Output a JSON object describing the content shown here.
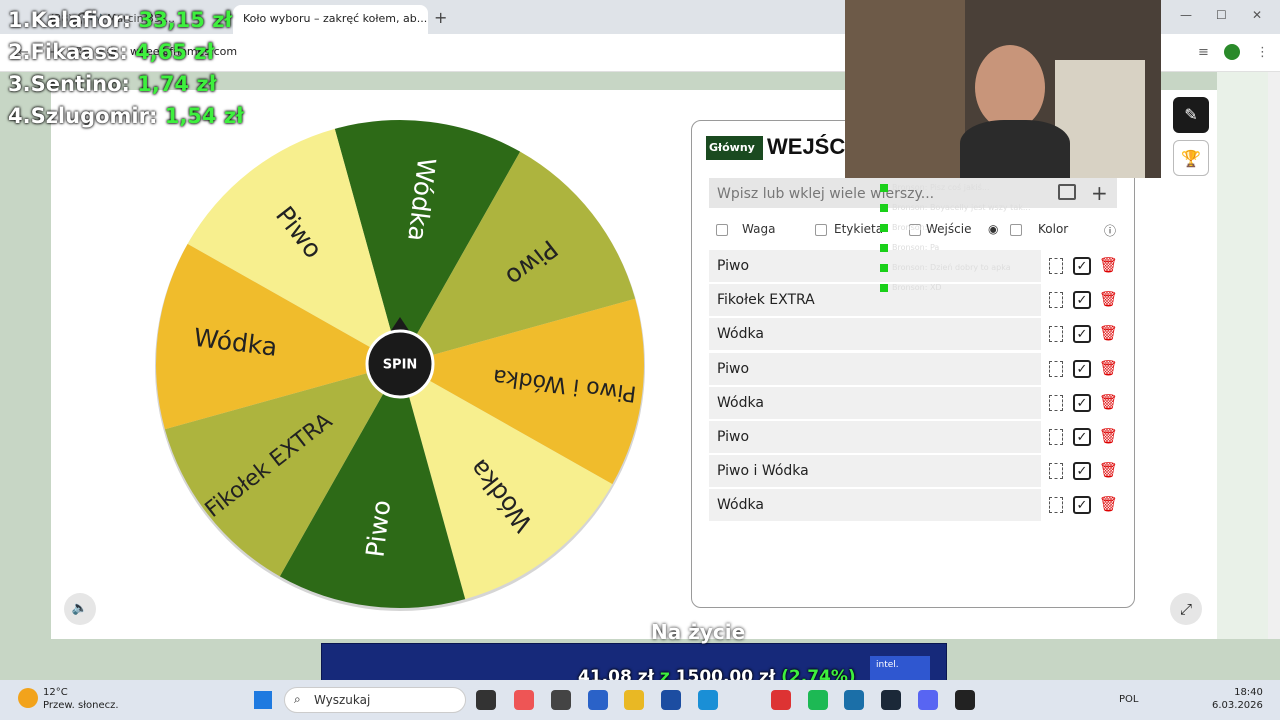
{
  "browser": {
    "tab1_title": "(28) 🎧🎶 Marcin 35 ...",
    "tab2_title": "Koło wyboru – zakręć kołem, ab...",
    "url": "wheelofnames.com"
  },
  "overlay": {
    "ranking": [
      {
        "label": "1.Kalafior:",
        "amount": "33,15 zł"
      },
      {
        "label": "2.Fikaass:",
        "amount": "4,65 zł"
      },
      {
        "label": "3.Sentino:",
        "amount": "1,74 zł"
      },
      {
        "label": "4.Szlugomir:",
        "amount": "1,54 zł"
      }
    ],
    "goal_label": "Na życie",
    "goal_current": "41,08 zł",
    "goal_sep": "z",
    "goal_target": "1500,00 zł",
    "goal_percent": "(2.74%)",
    "goal_fraction": 0.0274
  },
  "wheel": {
    "center_label": "SPIN",
    "segments": [
      {
        "label": "Wódka",
        "color": "#2d6a17",
        "text_color": "#ffffff"
      },
      {
        "label": "Piwo",
        "color": "#adb43e",
        "text_color": "#222222"
      },
      {
        "label": "Piwo i Wódka",
        "color": "#f0bc2c",
        "text_color": "#222222"
      },
      {
        "label": "Wódka",
        "color": "#f7ef8e",
        "text_color": "#222222"
      },
      {
        "label": "Piwo",
        "color": "#2d6a17",
        "text_color": "#ffffff"
      },
      {
        "label": "Fikołek EXTRA",
        "color": "#adb43e",
        "text_color": "#222222"
      },
      {
        "label": "Wódka",
        "color": "#f0bc2c",
        "text_color": "#222222"
      },
      {
        "label": "Piwo",
        "color": "#f7ef8e",
        "text_color": "#222222"
      }
    ]
  },
  "panel": {
    "logo": "Główny",
    "title": "WEJŚCIA",
    "input_placeholder": "Wpisz lub wklej wiele wierszy...",
    "options": {
      "waga": "Waga",
      "etykieta": "Etykieta",
      "wejscie": "Wejście",
      "kolor": "Kolor"
    },
    "entries": [
      "Piwo",
      "Fikołek EXTRA",
      "Wódka",
      "Piwo",
      "Wódka",
      "Piwo",
      "Piwo i Wódka",
      "Wódka"
    ]
  },
  "chat": [
    "Bronson: Pisz coś jakiś...",
    "Bronson: Boyacelly jest wszy tak...",
    "Bronson: ...",
    "Bronson: Pa",
    "Bronson: Dzień dobry to apka",
    "Bronson: XD"
  ],
  "taskbar": {
    "weather_temp": "12°C",
    "weather_desc": "Przew. słonecz.",
    "search_placeholder": "Wyszukaj",
    "lang": "POL",
    "time": "18:40",
    "date": "6.03.2026"
  }
}
